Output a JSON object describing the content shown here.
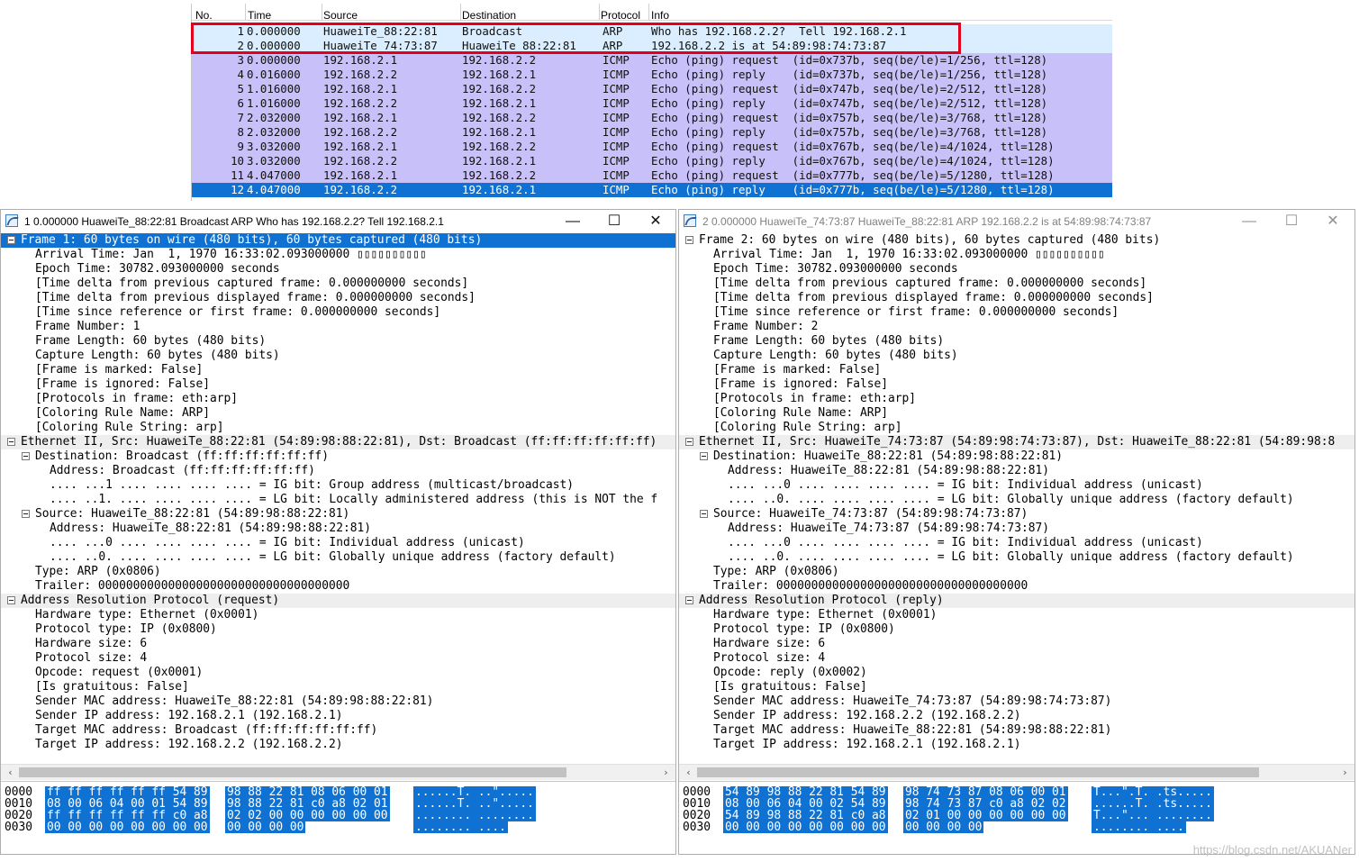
{
  "packet_list": {
    "columns": [
      "No.",
      "Time",
      "Source",
      "Destination",
      "Protocol",
      "Info"
    ],
    "rows": [
      {
        "no": "1",
        "time": "0.000000",
        "src": "HuaweiTe_88:22:81",
        "dst": "Broadcast",
        "proto": "ARP",
        "info": "Who has 192.168.2.2?  Tell 192.168.2.1",
        "kind": "arp"
      },
      {
        "no": "2",
        "time": "0.000000",
        "src": "HuaweiTe_74:73:87",
        "dst": "HuaweiTe_88:22:81",
        "proto": "ARP",
        "info": "192.168.2.2 is at 54:89:98:74:73:87",
        "kind": "arp"
      },
      {
        "no": "3",
        "time": "0.000000",
        "src": "192.168.2.1",
        "dst": "192.168.2.2",
        "proto": "ICMP",
        "info": "Echo (ping) request  (id=0x737b, seq(be/le)=1/256, ttl=128)",
        "kind": "icmp"
      },
      {
        "no": "4",
        "time": "0.016000",
        "src": "192.168.2.2",
        "dst": "192.168.2.1",
        "proto": "ICMP",
        "info": "Echo (ping) reply    (id=0x737b, seq(be/le)=1/256, ttl=128)",
        "kind": "icmp"
      },
      {
        "no": "5",
        "time": "1.016000",
        "src": "192.168.2.1",
        "dst": "192.168.2.2",
        "proto": "ICMP",
        "info": "Echo (ping) request  (id=0x747b, seq(be/le)=2/512, ttl=128)",
        "kind": "icmp"
      },
      {
        "no": "6",
        "time": "1.016000",
        "src": "192.168.2.2",
        "dst": "192.168.2.1",
        "proto": "ICMP",
        "info": "Echo (ping) reply    (id=0x747b, seq(be/le)=2/512, ttl=128)",
        "kind": "icmp"
      },
      {
        "no": "7",
        "time": "2.032000",
        "src": "192.168.2.1",
        "dst": "192.168.2.2",
        "proto": "ICMP",
        "info": "Echo (ping) request  (id=0x757b, seq(be/le)=3/768, ttl=128)",
        "kind": "icmp"
      },
      {
        "no": "8",
        "time": "2.032000",
        "src": "192.168.2.2",
        "dst": "192.168.2.1",
        "proto": "ICMP",
        "info": "Echo (ping) reply    (id=0x757b, seq(be/le)=3/768, ttl=128)",
        "kind": "icmp"
      },
      {
        "no": "9",
        "time": "3.032000",
        "src": "192.168.2.1",
        "dst": "192.168.2.2",
        "proto": "ICMP",
        "info": "Echo (ping) request  (id=0x767b, seq(be/le)=4/1024, ttl=128)",
        "kind": "icmp"
      },
      {
        "no": "10",
        "time": "3.032000",
        "src": "192.168.2.2",
        "dst": "192.168.2.1",
        "proto": "ICMP",
        "info": "Echo (ping) reply    (id=0x767b, seq(be/le)=4/1024, ttl=128)",
        "kind": "icmp"
      },
      {
        "no": "11",
        "time": "4.047000",
        "src": "192.168.2.1",
        "dst": "192.168.2.2",
        "proto": "ICMP",
        "info": "Echo (ping) request  (id=0x777b, seq(be/le)=5/1280, ttl=128)",
        "kind": "icmp"
      },
      {
        "no": "12",
        "time": "4.047000",
        "src": "192.168.2.2",
        "dst": "192.168.2.1",
        "proto": "ICMP",
        "info": "Echo (ping) reply    (id=0x777b, seq(be/le)=5/1280, ttl=128)",
        "kind": "sel"
      }
    ]
  },
  "windows": [
    {
      "title": "1 0.000000 HuaweiTe_88:22:81 Broadcast ARP Who has 192.168.2.2?  Tell 192.168.2.1",
      "buttons": {
        "minimize": "—",
        "maximize": "☐",
        "close": "✕"
      },
      "tree": [
        {
          "d": 0,
          "exp": true,
          "sel": true,
          "t": "Frame 1: 60 bytes on wire (480 bits), 60 bytes captured (480 bits)"
        },
        {
          "d": 1,
          "t": "Arrival Time: Jan  1, 1970 16:33:02.093000000 ▯▯▯▯▯▯▯▯▯▯"
        },
        {
          "d": 1,
          "t": "Epoch Time: 30782.093000000 seconds"
        },
        {
          "d": 1,
          "t": "[Time delta from previous captured frame: 0.000000000 seconds]"
        },
        {
          "d": 1,
          "t": "[Time delta from previous displayed frame: 0.000000000 seconds]"
        },
        {
          "d": 1,
          "t": "[Time since reference or first frame: 0.000000000 seconds]"
        },
        {
          "d": 1,
          "t": "Frame Number: 1"
        },
        {
          "d": 1,
          "t": "Frame Length: 60 bytes (480 bits)"
        },
        {
          "d": 1,
          "t": "Capture Length: 60 bytes (480 bits)"
        },
        {
          "d": 1,
          "t": "[Frame is marked: False]"
        },
        {
          "d": 1,
          "t": "[Frame is ignored: False]"
        },
        {
          "d": 1,
          "t": "[Protocols in frame: eth:arp]"
        },
        {
          "d": 1,
          "t": "[Coloring Rule Name: ARP]"
        },
        {
          "d": 1,
          "t": "[Coloring Rule String: arp]"
        },
        {
          "d": 0,
          "exp": true,
          "sec": true,
          "t": "Ethernet II, Src: HuaweiTe_88:22:81 (54:89:98:88:22:81), Dst: Broadcast (ff:ff:ff:ff:ff:ff)"
        },
        {
          "d": 1,
          "exp": true,
          "t": "Destination: Broadcast (ff:ff:ff:ff:ff:ff)"
        },
        {
          "d": 2,
          "t": "Address: Broadcast (ff:ff:ff:ff:ff:ff)"
        },
        {
          "d": 2,
          "t": ".... ...1 .... .... .... .... = IG bit: Group address (multicast/broadcast)"
        },
        {
          "d": 2,
          "t": ".... ..1. .... .... .... .... = LG bit: Locally administered address (this is NOT the f"
        },
        {
          "d": 1,
          "exp": true,
          "t": "Source: HuaweiTe_88:22:81 (54:89:98:88:22:81)"
        },
        {
          "d": 2,
          "t": "Address: HuaweiTe_88:22:81 (54:89:98:88:22:81)"
        },
        {
          "d": 2,
          "t": ".... ...0 .... .... .... .... = IG bit: Individual address (unicast)"
        },
        {
          "d": 2,
          "t": ".... ..0. .... .... .... .... = LG bit: Globally unique address (factory default)"
        },
        {
          "d": 1,
          "t": "Type: ARP (0x0806)"
        },
        {
          "d": 1,
          "t": "Trailer: 000000000000000000000000000000000000"
        },
        {
          "d": 0,
          "exp": true,
          "sec": true,
          "t": "Address Resolution Protocol (request)"
        },
        {
          "d": 1,
          "t": "Hardware type: Ethernet (0x0001)"
        },
        {
          "d": 1,
          "t": "Protocol type: IP (0x0800)"
        },
        {
          "d": 1,
          "t": "Hardware size: 6"
        },
        {
          "d": 1,
          "t": "Protocol size: 4"
        },
        {
          "d": 1,
          "t": "Opcode: request (0x0001)"
        },
        {
          "d": 1,
          "t": "[Is gratuitous: False]"
        },
        {
          "d": 1,
          "t": "Sender MAC address: HuaweiTe_88:22:81 (54:89:98:88:22:81)"
        },
        {
          "d": 1,
          "t": "Sender IP address: 192.168.2.1 (192.168.2.1)"
        },
        {
          "d": 1,
          "t": "Target MAC address: Broadcast (ff:ff:ff:ff:ff:ff)"
        },
        {
          "d": 1,
          "t": "Target IP address: 192.168.2.2 (192.168.2.2)"
        }
      ],
      "scroll": {
        "left": "‹",
        "right": "›"
      },
      "hex": [
        {
          "off": "0000",
          "a": "ff ff ff ff ff ff 54 89",
          "b": "98 88 22 81 08 06 00 01",
          "asc": "......T. ..\"....."
        },
        {
          "off": "0010",
          "a": "08 00 06 04 00 01 54 89",
          "b": "98 88 22 81 c0 a8 02 01",
          "asc": "......T. ..\"....."
        },
        {
          "off": "0020",
          "a": "ff ff ff ff ff ff c0 a8",
          "b": "02 02 00 00 00 00 00 00",
          "asc": "........ ........"
        },
        {
          "off": "0030",
          "a": "00 00 00 00 00 00 00 00",
          "b": "00 00 00 00",
          "asc": "........ ...."
        }
      ]
    },
    {
      "title": "2 0.000000 HuaweiTe_74:73:87 HuaweiTe_88:22:81 ARP 192.168.2.2 is at 54:89:98:74:73:87",
      "buttons": {
        "minimize": "—",
        "maximize": "☐",
        "close": "✕"
      },
      "tree": [
        {
          "d": 0,
          "exp": true,
          "t": "Frame 2: 60 bytes on wire (480 bits), 60 bytes captured (480 bits)"
        },
        {
          "d": 1,
          "t": "Arrival Time: Jan  1, 1970 16:33:02.093000000 ▯▯▯▯▯▯▯▯▯▯"
        },
        {
          "d": 1,
          "t": "Epoch Time: 30782.093000000 seconds"
        },
        {
          "d": 1,
          "t": "[Time delta from previous captured frame: 0.000000000 seconds]"
        },
        {
          "d": 1,
          "t": "[Time delta from previous displayed frame: 0.000000000 seconds]"
        },
        {
          "d": 1,
          "t": "[Time since reference or first frame: 0.000000000 seconds]"
        },
        {
          "d": 1,
          "t": "Frame Number: 2"
        },
        {
          "d": 1,
          "t": "Frame Length: 60 bytes (480 bits)"
        },
        {
          "d": 1,
          "t": "Capture Length: 60 bytes (480 bits)"
        },
        {
          "d": 1,
          "t": "[Frame is marked: False]"
        },
        {
          "d": 1,
          "t": "[Frame is ignored: False]"
        },
        {
          "d": 1,
          "t": "[Protocols in frame: eth:arp]"
        },
        {
          "d": 1,
          "t": "[Coloring Rule Name: ARP]"
        },
        {
          "d": 1,
          "t": "[Coloring Rule String: arp]"
        },
        {
          "d": 0,
          "exp": true,
          "sec": true,
          "t": "Ethernet II, Src: HuaweiTe_74:73:87 (54:89:98:74:73:87), Dst: HuaweiTe_88:22:81 (54:89:98:8"
        },
        {
          "d": 1,
          "exp": true,
          "t": "Destination: HuaweiTe_88:22:81 (54:89:98:88:22:81)"
        },
        {
          "d": 2,
          "t": "Address: HuaweiTe_88:22:81 (54:89:98:88:22:81)"
        },
        {
          "d": 2,
          "t": ".... ...0 .... .... .... .... = IG bit: Individual address (unicast)"
        },
        {
          "d": 2,
          "t": ".... ..0. .... .... .... .... = LG bit: Globally unique address (factory default)"
        },
        {
          "d": 1,
          "exp": true,
          "t": "Source: HuaweiTe_74:73:87 (54:89:98:74:73:87)"
        },
        {
          "d": 2,
          "t": "Address: HuaweiTe_74:73:87 (54:89:98:74:73:87)"
        },
        {
          "d": 2,
          "t": ".... ...0 .... .... .... .... = IG bit: Individual address (unicast)"
        },
        {
          "d": 2,
          "t": ".... ..0. .... .... .... .... = LG bit: Globally unique address (factory default)"
        },
        {
          "d": 1,
          "t": "Type: ARP (0x0806)"
        },
        {
          "d": 1,
          "t": "Trailer: 000000000000000000000000000000000000"
        },
        {
          "d": 0,
          "exp": true,
          "sec": true,
          "t": "Address Resolution Protocol (reply)"
        },
        {
          "d": 1,
          "t": "Hardware type: Ethernet (0x0001)"
        },
        {
          "d": 1,
          "t": "Protocol type: IP (0x0800)"
        },
        {
          "d": 1,
          "t": "Hardware size: 6"
        },
        {
          "d": 1,
          "t": "Protocol size: 4"
        },
        {
          "d": 1,
          "t": "Opcode: reply (0x0002)"
        },
        {
          "d": 1,
          "t": "[Is gratuitous: False]"
        },
        {
          "d": 1,
          "t": "Sender MAC address: HuaweiTe_74:73:87 (54:89:98:74:73:87)"
        },
        {
          "d": 1,
          "t": "Sender IP address: 192.168.2.2 (192.168.2.2)"
        },
        {
          "d": 1,
          "t": "Target MAC address: HuaweiTe_88:22:81 (54:89:98:88:22:81)"
        },
        {
          "d": 1,
          "t": "Target IP address: 192.168.2.1 (192.168.2.1)"
        }
      ],
      "scroll": {
        "left": "‹",
        "right": "›"
      },
      "hex": [
        {
          "off": "0000",
          "a": "54 89 98 88 22 81 54 89",
          "b": "98 74 73 87 08 06 00 01",
          "asc": "T...\".T. .ts....."
        },
        {
          "off": "0010",
          "a": "08 00 06 04 00 02 54 89",
          "b": "98 74 73 87 c0 a8 02 02",
          "asc": "......T. .ts....."
        },
        {
          "off": "0020",
          "a": "54 89 98 88 22 81 c0 a8",
          "b": "02 01 00 00 00 00 00 00",
          "asc": "T...\"... ........"
        },
        {
          "off": "0030",
          "a": "00 00 00 00 00 00 00 00",
          "b": "00 00 00 00",
          "asc": "........ ...."
        }
      ]
    }
  ],
  "watermark": "https://blog.csdn.net/AKUANer"
}
